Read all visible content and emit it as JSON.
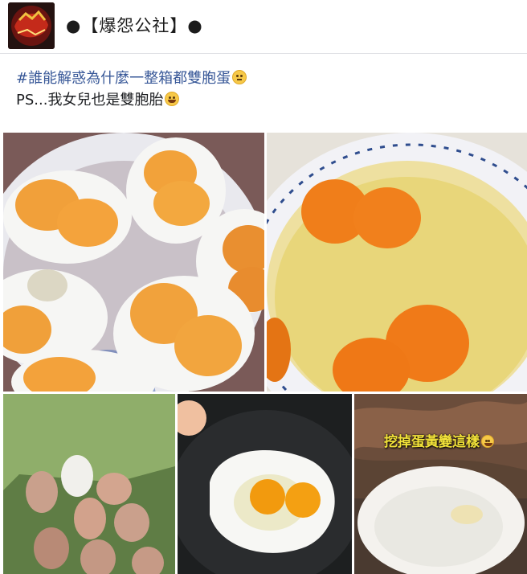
{
  "header": {
    "page_name": "●【爆怨公社】●",
    "avatar_text": "爆怨公社"
  },
  "post": {
    "hashtag": "#誰能解惑為什麼一整箱都雙胞蛋",
    "emoji1": "thinking-face",
    "line2": "PS...我女兒也是雙胞胎",
    "emoji2": "grinning-squinting-face"
  },
  "photos": [
    {
      "name": "boiled-double-yolk-eggs-photo"
    },
    {
      "name": "raw-double-yolk-eggs-bowl-photo"
    },
    {
      "name": "egg-box-photo"
    },
    {
      "name": "fried-double-yolk-egg-photo"
    },
    {
      "name": "hollowed-egg-photo",
      "caption": "挖掉蛋黃變這樣"
    }
  ],
  "colors": {
    "hashtag": "#385898",
    "caption": "#f3e23a"
  }
}
